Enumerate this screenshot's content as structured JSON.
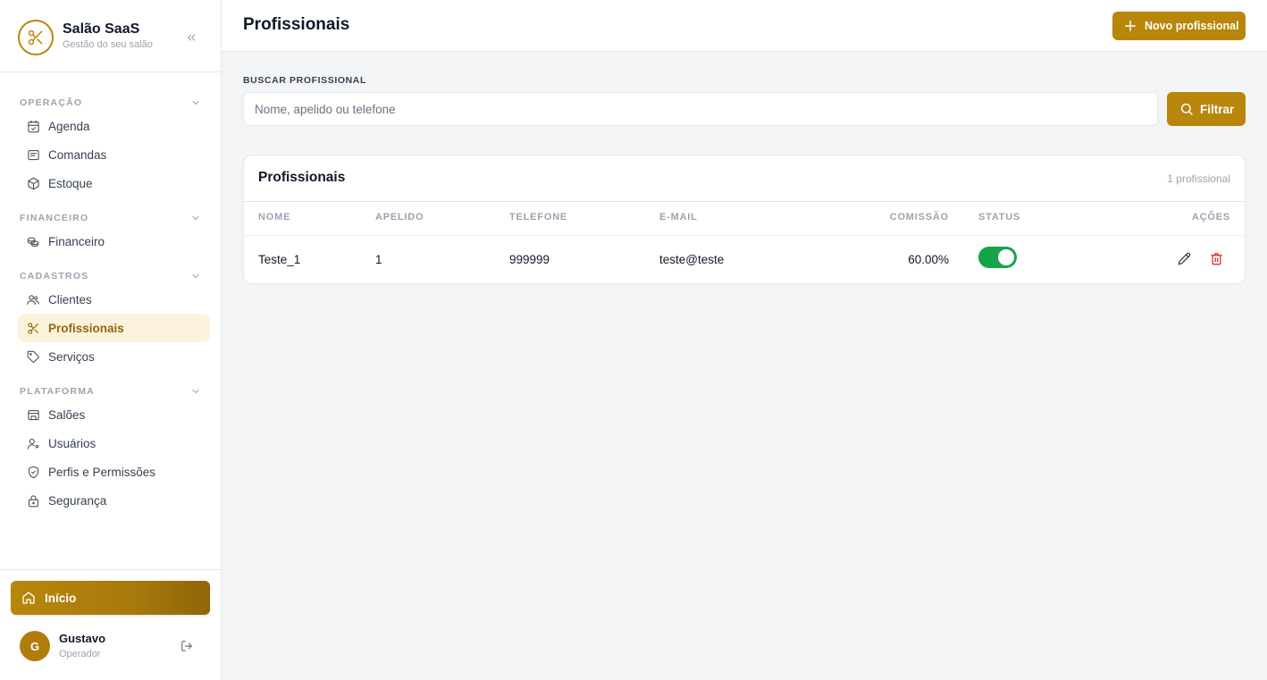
{
  "brand": {
    "name": "Salão SaaS",
    "subtitle": "Gestão do seu salão",
    "logo_icon": "scissors-icon"
  },
  "sidebar": {
    "sections": [
      {
        "title": "OPERAÇÃO",
        "items": [
          {
            "label": "Agenda",
            "icon": "calendar-check-icon"
          },
          {
            "label": "Comandas",
            "icon": "receipt-icon"
          },
          {
            "label": "Estoque",
            "icon": "package-icon"
          }
        ]
      },
      {
        "title": "FINANCEIRO",
        "items": [
          {
            "label": "Financeiro",
            "icon": "coins-icon"
          }
        ]
      },
      {
        "title": "CADASTROS",
        "items": [
          {
            "label": "Clientes",
            "icon": "users-icon"
          },
          {
            "label": "Profissionais",
            "icon": "scissors-icon",
            "active": true
          },
          {
            "label": "Serviços",
            "icon": "tag-icon"
          }
        ]
      },
      {
        "title": "PLATAFORMA",
        "items": [
          {
            "label": "Salões",
            "icon": "store-icon"
          },
          {
            "label": "Usuários",
            "icon": "user-cog-icon"
          },
          {
            "label": "Perfis e Permissões",
            "icon": "shield-check-icon"
          },
          {
            "label": "Segurança",
            "icon": "lock-icon"
          }
        ]
      }
    ],
    "home_label": "Início",
    "user": {
      "initial": "G",
      "name": "Gustavo",
      "role": "Operador"
    }
  },
  "header": {
    "title": "Profissionais",
    "new_button_label": "Novo profissional"
  },
  "search": {
    "label": "BUSCAR PROFISSIONAL",
    "placeholder": "Nome, apelido ou telefone",
    "value": "",
    "filter_label": "Filtrar"
  },
  "table": {
    "title": "Profissionais",
    "count": "1 profissional",
    "columns": [
      "NOME",
      "APELIDO",
      "TELEFONE",
      "E-MAIL",
      "COMISSÃO",
      "STATUS",
      "AÇÕES"
    ],
    "rows": [
      {
        "nome": "Teste_1",
        "apelido": "1",
        "telefone": "999999",
        "email": "teste@teste",
        "comissao": "60.00%",
        "status_active": true
      }
    ]
  },
  "colors": {
    "accent": "#b8860b",
    "active_bg": "#fdf3dc",
    "toggle_on": "#16a34a",
    "danger": "#dc2626"
  }
}
